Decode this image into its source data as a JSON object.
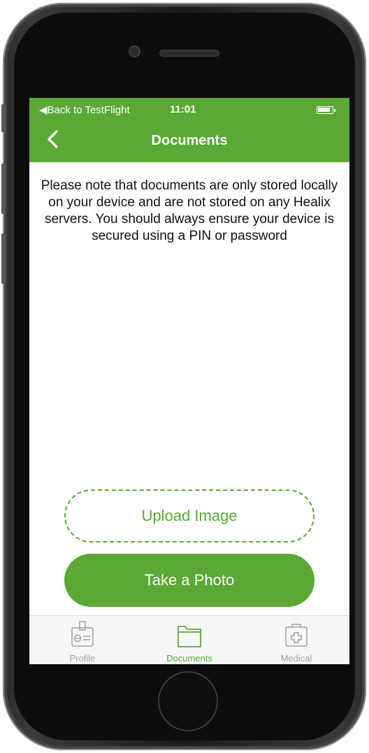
{
  "colors": {
    "accent": "#5aa935",
    "inactive": "#a1a1a1"
  },
  "status_bar": {
    "back_label": "Back to TestFlight",
    "time": "11:01"
  },
  "nav": {
    "title": "Documents",
    "back_icon": "chevron-left-icon"
  },
  "notice": "Please note that documents are only stored locally on your device and are not stored on any Healix servers. You should always ensure your device is secured using a PIN or password",
  "buttons": {
    "upload_label": "Upload Image",
    "photo_label": "Take a Photo"
  },
  "tabs": [
    {
      "label": "Profile",
      "icon": "id-badge-icon",
      "active": false
    },
    {
      "label": "Documents",
      "icon": "folder-icon",
      "active": true
    },
    {
      "label": "Medical",
      "icon": "medical-kit-icon",
      "active": false
    }
  ]
}
